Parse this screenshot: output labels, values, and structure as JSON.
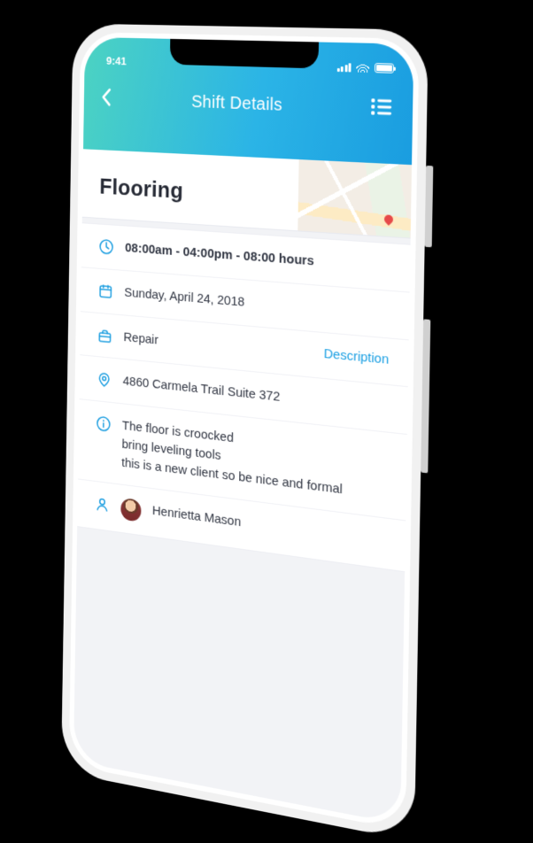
{
  "status": {
    "time": "9:41"
  },
  "nav": {
    "title": "Shift Details"
  },
  "job": {
    "title": "Flooring"
  },
  "details": {
    "time_range": "08:00am - 04:00pm - 08:00 hours",
    "date": "Sunday, April 24, 2018",
    "service": "Repair",
    "service_link": "Description",
    "address": "4860 Carmela Trail Suite 372",
    "notes": "The floor is croocked\nbring leveling tools\nthis is a new client so be nice and formal",
    "client_name": "Henrietta Mason"
  }
}
